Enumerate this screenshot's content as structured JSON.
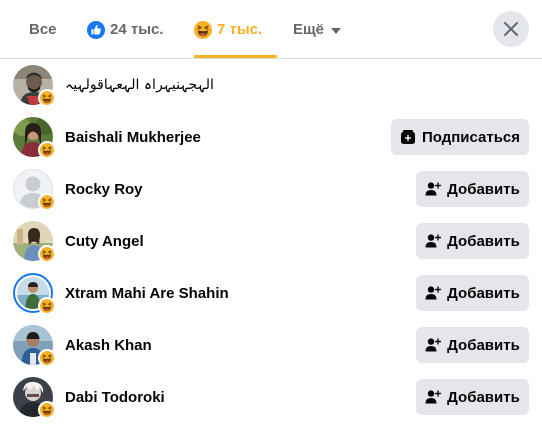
{
  "tabs": {
    "all_label": "Все",
    "like_count": "24 тыс.",
    "haha_count": "7 тыс.",
    "more_label": "Ещё"
  },
  "accent": "#f7b125",
  "reactors": [
    {
      "name": "الہجہنیہراہ الہعہاقولہیہ",
      "action": "",
      "avatar": "photo-dark"
    },
    {
      "name": "Baishali Mukherjee",
      "action": "Подписаться",
      "avatar": "photo-green"
    },
    {
      "name": "Rocky Roy",
      "action": "Добавить",
      "avatar": "default-silhouette"
    },
    {
      "name": "Cuty Angel",
      "action": "Добавить",
      "avatar": "photo-beige"
    },
    {
      "name": "Xtram Mahi Are Shahin",
      "action": "Добавить",
      "avatar": "photo-story"
    },
    {
      "name": "Akash Khan",
      "action": "Добавить",
      "avatar": "photo-blue"
    },
    {
      "name": "Dabi Todoroki",
      "action": "Добавить",
      "avatar": "photo-gray"
    }
  ]
}
